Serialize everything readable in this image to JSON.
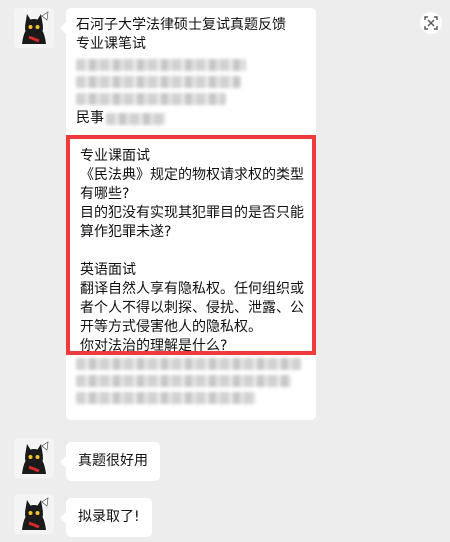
{
  "message1": {
    "lines": [
      "石河子大学法律硕士复试真题反馈",
      "专业课笔试"
    ],
    "partial_line": "民事",
    "highlight": {
      "section1_title": "专业课面试",
      "section1_lines": [
        "《民法典》规定的物权请求权的类型",
        "有哪些?",
        "目的犯没有实现其犯罪目的是否只能",
        "算作犯罪未遂?"
      ],
      "section2_title": "英语面试",
      "section2_lines": [
        "翻译自然人享有隐私权。任何组织或",
        "者个人不得以刺探、侵扰、泄露、公",
        "开等方式侵害他人的隐私权。",
        "你对法治的理解是什么?"
      ]
    },
    "highlight_border_color": "#ef3b3b"
  },
  "message2": {
    "text": "真题很好用"
  },
  "message3": {
    "text": "拟录取了!"
  },
  "icons": {
    "avatar": "cat-avatar-icon",
    "top_right": "screenshot-icon"
  }
}
